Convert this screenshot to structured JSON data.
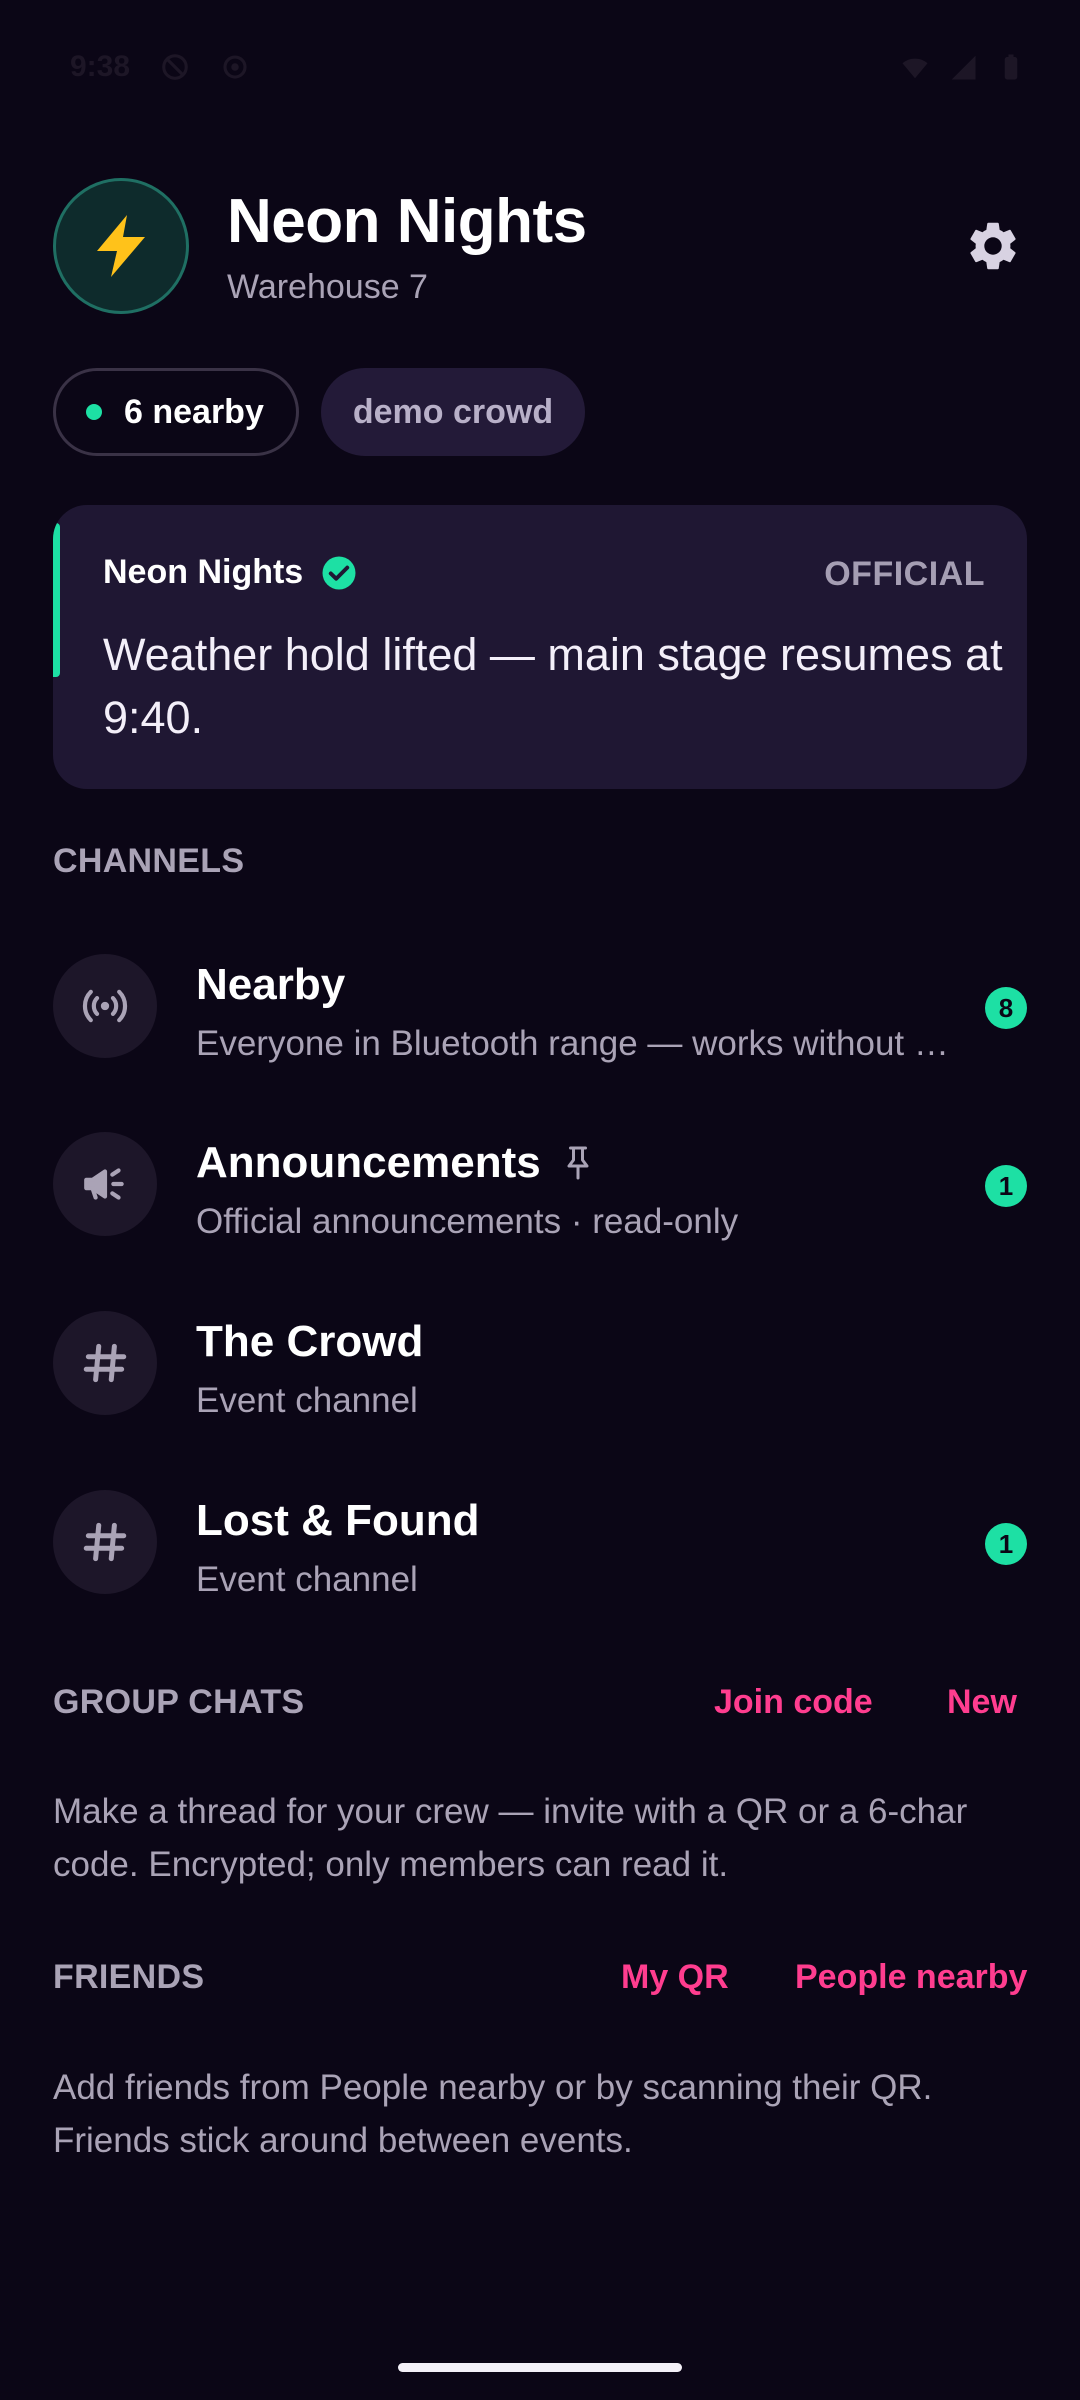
{
  "status_bar": {
    "time": "9:38",
    "left_icons": [
      "do-not-disturb-icon",
      "hotspot-icon"
    ],
    "right_icons": [
      "wifi-icon",
      "signal-icon",
      "battery-icon"
    ]
  },
  "header": {
    "logo_icon": "lightning-bolt-icon",
    "title": "Neon Nights",
    "venue": "Warehouse 7",
    "settings_icon": "gear-icon"
  },
  "chips": {
    "nearby_label": "6 nearby",
    "demo_label": "demo crowd"
  },
  "announcement": {
    "sender": "Neon Nights",
    "tag": "OFFICIAL",
    "message": "Weather hold lifted — main stage resumes at 9:40.",
    "accent_color": "#1de0a4"
  },
  "channels": {
    "section_title": "CHANNELS",
    "items": [
      {
        "icon": "broadcast-icon",
        "title": "Nearby",
        "subtitle": "Everyone in Bluetooth range — works without …",
        "badge": "8"
      },
      {
        "icon": "megaphone-icon",
        "title": "Announcements",
        "pinned": true,
        "subtitle": "Official announcements · read-only",
        "badge": "1"
      },
      {
        "icon": "hash-icon",
        "title": "The Crowd",
        "subtitle": "Event channel",
        "badge": ""
      },
      {
        "icon": "hash-icon",
        "title": "Lost & Found",
        "subtitle": "Event channel",
        "badge": "1"
      }
    ]
  },
  "group_chats": {
    "section_title": "GROUP CHATS",
    "join_code_label": "Join code",
    "new_label": "New",
    "description": "Make a thread for your crew — invite with a QR or a 6-char code. Encrypted; only members can read it."
  },
  "friends": {
    "section_title": "FRIENDS",
    "my_qr_label": "My QR",
    "people_nearby_label": "People nearby",
    "description": "Add friends from People nearby or by scanning their QR. Friends stick around between events."
  },
  "colors": {
    "background": "#0b0616",
    "accent_green": "#1de0a4",
    "accent_pink": "#ff3d8f",
    "card": "#1f1733"
  }
}
